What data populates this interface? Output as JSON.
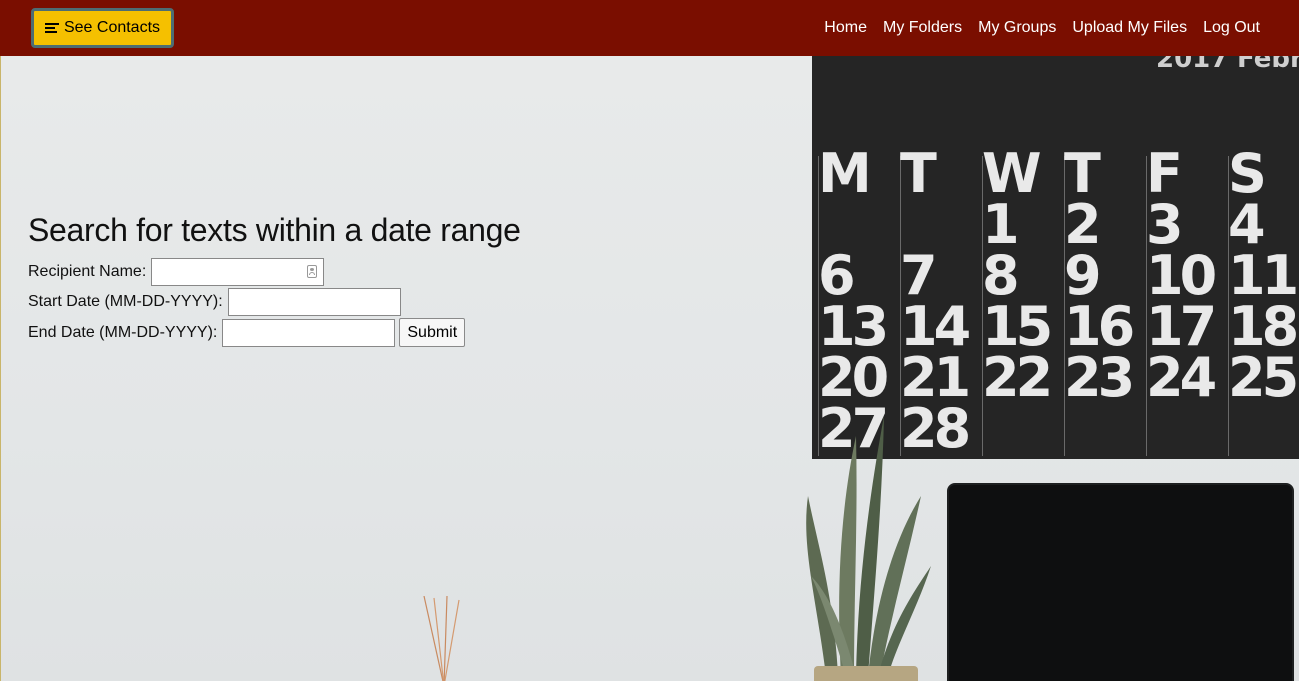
{
  "nav": {
    "contacts_button": "See Contacts",
    "links": [
      "Home",
      "My Folders",
      "My Groups",
      "Upload My Files",
      "Log Out"
    ]
  },
  "form": {
    "title": "Search for texts within a date range",
    "recipient_label": "Recipient Name:",
    "recipient_value": "",
    "start_label": "Start Date (MM-DD-YYYY):",
    "start_value": "",
    "end_label": "End Date (MM-DD-YYYY):",
    "end_value": "",
    "submit_label": "Submit"
  },
  "background_calendar": {
    "year": "2017",
    "month": "Febru",
    "days_of_week": [
      "M",
      "T",
      "W",
      "T",
      "F",
      "S"
    ],
    "dates": [
      [
        "",
        "",
        "1",
        "2",
        "3",
        "4"
      ],
      [
        "6",
        "7",
        "8",
        "9",
        "10",
        "11"
      ],
      [
        "13",
        "14",
        "15",
        "16",
        "17",
        "18"
      ],
      [
        "20",
        "21",
        "22",
        "23",
        "24",
        "25"
      ],
      [
        "27",
        "28",
        "",
        "",
        "",
        ""
      ]
    ]
  },
  "colors": {
    "navbar": "#7a0e00",
    "contacts_button": "#f5c000",
    "contacts_button_border": "#4d6d73"
  },
  "icons": {
    "contacts_button_icon": "menu-lines-icon",
    "recipient_field_icon": "contact-card-icon"
  }
}
